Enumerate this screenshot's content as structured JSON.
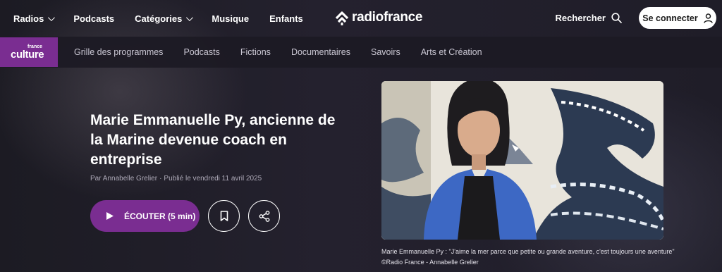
{
  "topnav": {
    "radios": "Radios",
    "podcasts": "Podcasts",
    "categories": "Catégories",
    "music": "Musique",
    "kids": "Enfants"
  },
  "brand": {
    "name": "radiofrance"
  },
  "header_right": {
    "search": "Rechercher",
    "login": "Se connecter"
  },
  "station": {
    "small": "france",
    "name": "culture",
    "color": "#7a2d91"
  },
  "subnav": [
    "Grille des programmes",
    "Podcasts",
    "Fictions",
    "Documentaires",
    "Savoirs",
    "Arts et Création"
  ],
  "article": {
    "title": "Marie Emmanuelle Py, ancienne de la Marine devenue coach en entreprise",
    "author": "Par Annabelle Grelier",
    "published": "Publié le vendredi 11 avril 2025",
    "listen_label": "ÉCOUTER",
    "duration": "(5 min)"
  },
  "image": {
    "caption": "Marie Emmanuelle Py : \"J'aime la mer parce que petite ou grande aventure, c'est toujours une aventure\"",
    "credit": "©Radio France - Annabelle Grelier"
  }
}
